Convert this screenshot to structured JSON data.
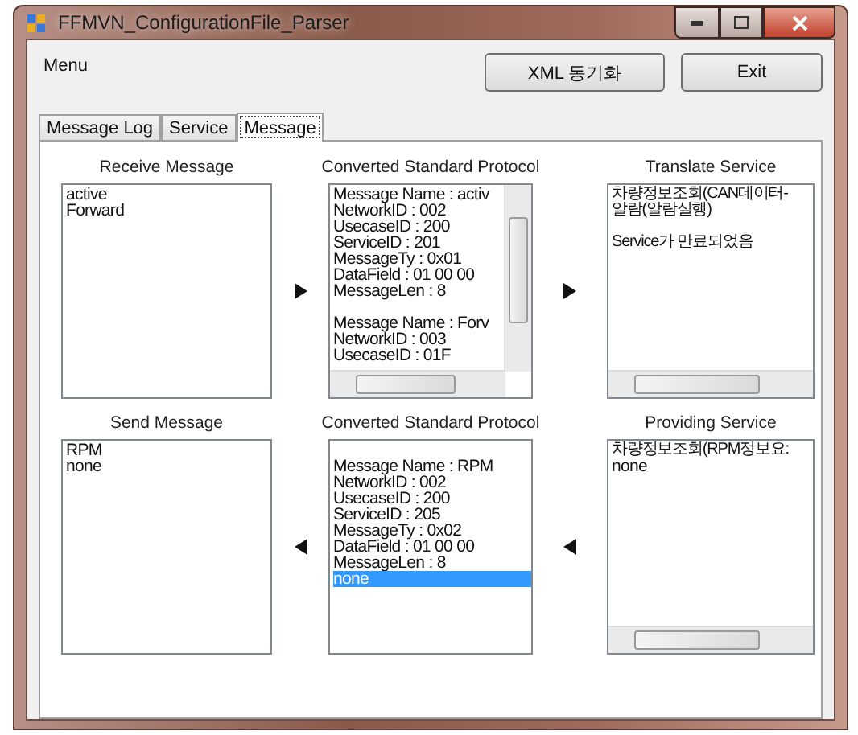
{
  "window": {
    "title": "FFMVN_ConfigurationFile_Parser"
  },
  "menu": [
    "Menu"
  ],
  "buttons": [
    "XML 동기화",
    "Exit"
  ],
  "tabs": [
    {
      "label": "Message Log",
      "selected": false
    },
    {
      "label": "Service",
      "selected": false
    },
    {
      "label": "Message",
      "selected": true
    }
  ],
  "rows": [
    {
      "kind": "right",
      "panels": [
        {
          "title": "Receive Message",
          "kind": "plain",
          "items": [
            {
              "kind": "text",
              "text": "active",
              "selected": false
            },
            {
              "kind": "text",
              "text": "Forward",
              "selected": false
            }
          ]
        },
        {
          "title": "Converted Standard Protocol",
          "kind": "scroll_both",
          "items": [
            {
              "kind": "text",
              "text": "Message Name : activ",
              "selected": false
            },
            {
              "kind": "text",
              "text": "NetworkID : 002",
              "selected": false
            },
            {
              "kind": "text",
              "text": "UsecaseID : 200",
              "selected": false
            },
            {
              "kind": "text",
              "text": "ServiceID : 201",
              "selected": false
            },
            {
              "kind": "text",
              "text": "MessageTy : 0x01",
              "selected": false
            },
            {
              "kind": "text",
              "text": "DataField : 01 00 00",
              "selected": false
            },
            {
              "kind": "text",
              "text": "MessageLen : 8",
              "selected": false
            },
            {
              "kind": "blank"
            },
            {
              "kind": "text",
              "text": "Message Name : Forv",
              "selected": false
            },
            {
              "kind": "text",
              "text": "NetworkID : 003",
              "selected": false
            },
            {
              "kind": "text",
              "text": "UsecaseID : 01F",
              "selected": false
            }
          ]
        },
        {
          "title": "Translate Service",
          "kind": "scroll_h",
          "items": [
            {
              "kind": "text",
              "text": "차량정보조회(CAN데이터-",
              "selected": false
            },
            {
              "kind": "text",
              "text": "알람(알람실행)",
              "selected": false
            },
            {
              "kind": "blank"
            },
            {
              "kind": "text",
              "text": "Service가 만료되었음",
              "selected": false
            }
          ]
        }
      ]
    },
    {
      "kind": "left",
      "panels": [
        {
          "title": "Send Message",
          "kind": "plain",
          "items": [
            {
              "kind": "text",
              "text": "RPM",
              "selected": false
            },
            {
              "kind": "text",
              "text": "none",
              "selected": false
            }
          ]
        },
        {
          "title": "Converted Standard Protocol",
          "kind": "plain",
          "items": [
            {
              "kind": "blank"
            },
            {
              "kind": "text",
              "text": "Message Name : RPM",
              "selected": false
            },
            {
              "kind": "text",
              "text": "NetworkID : 002",
              "selected": false
            },
            {
              "kind": "text",
              "text": "UsecaseID : 200",
              "selected": false
            },
            {
              "kind": "text",
              "text": "ServiceID : 205",
              "selected": false
            },
            {
              "kind": "text",
              "text": "MessageTy : 0x02",
              "selected": false
            },
            {
              "kind": "text",
              "text": "DataField : 01 00 00",
              "selected": false
            },
            {
              "kind": "text",
              "text": "MessageLen : 8",
              "selected": false
            },
            {
              "kind": "text",
              "text": "none",
              "selected": true
            }
          ]
        },
        {
          "title": "Providing Service",
          "kind": "scroll_h",
          "items": [
            {
              "kind": "text",
              "text": "차량정보조회(RPM정보요:",
              "selected": false
            },
            {
              "kind": "text",
              "text": "none",
              "selected": false
            }
          ]
        }
      ]
    }
  ]
}
